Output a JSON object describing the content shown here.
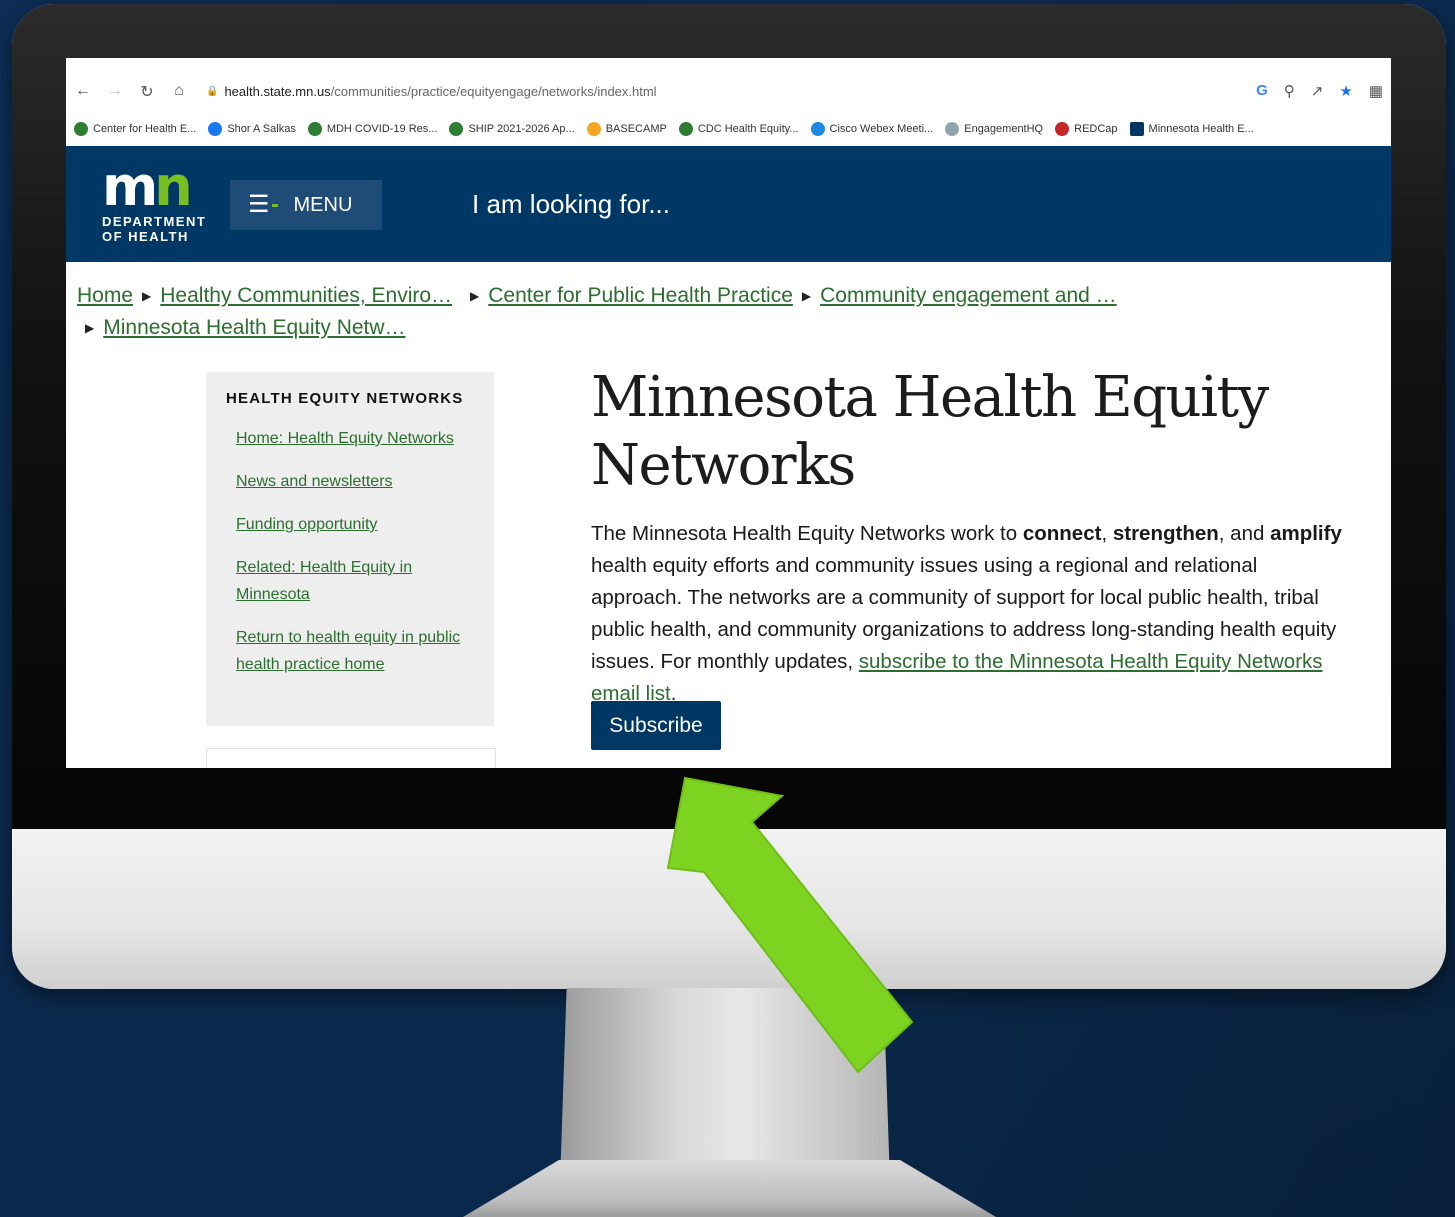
{
  "browser": {
    "url_host": "health.state.mn.us",
    "url_path": "/communities/practice/equityengage/networks/index.html",
    "nav_icons": [
      "back-icon",
      "forward-icon",
      "reload-icon",
      "home-icon"
    ],
    "bookmarks": [
      {
        "label": "Center for Health E...",
        "color": "#2e7d32"
      },
      {
        "label": "Shor A Salkas",
        "color": "#1877f2"
      },
      {
        "label": "MDH COVID-19 Res...",
        "color": "#2e7d32"
      },
      {
        "label": "SHIP 2021-2026 Ap...",
        "color": "#2e7d32"
      },
      {
        "label": "BASECAMP",
        "color": "#f5a623"
      },
      {
        "label": "CDC Health Equity...",
        "color": "#2e7d32"
      },
      {
        "label": "Cisco Webex Meeti...",
        "color": "#1e88e5"
      },
      {
        "label": "EngagementHQ",
        "color": "#90a4ae"
      },
      {
        "label": "REDCap",
        "color": "#c62828"
      },
      {
        "label": "Minnesota Health E...",
        "color": "#003865"
      }
    ]
  },
  "header": {
    "logo_mn": "mn",
    "logo_line1": "DEPARTMENT",
    "logo_line2": "OF HEALTH",
    "menu_label": "MENU",
    "search_placeholder": "I am looking for..."
  },
  "breadcrumb": {
    "items": [
      "Home",
      "Healthy Communities, Enviro…",
      "Center for Public Health Practice",
      "Community engagement and …",
      "Minnesota Health Equity Netw…"
    ]
  },
  "sidebar": {
    "title": "HEALTH EQUITY NETWORKS",
    "links": [
      "Home: Health Equity Networks",
      "News and newsletters",
      "Funding opportunity",
      "Related: Health Equity in Minnesota",
      "Return to health equity in public health practice home"
    ]
  },
  "main": {
    "title": "Minnesota Health Equity Networks",
    "intro_1": "The Minnesota Health Equity Networks work to ",
    "bold_1": "connect",
    "sep_1": ", ",
    "bold_2": "strengthen",
    "sep_2": ", and ",
    "bold_3": "amplify",
    "intro_2": " health equity efforts and community issues using a regional and relational approach. The networks are a community of support for local public health, tribal public health, and community organizations to address long-standing health equity issues. For monthly updates, ",
    "link_text": "subscribe to the Minnesota Health Equity Networks email list",
    "intro_end": ".",
    "subscribe_label": "Subscribe"
  },
  "colors": {
    "brand_navy": "#003865",
    "brand_green": "#78be20",
    "link_green": "#2b6e2f",
    "arrow_green": "#7ed321"
  }
}
